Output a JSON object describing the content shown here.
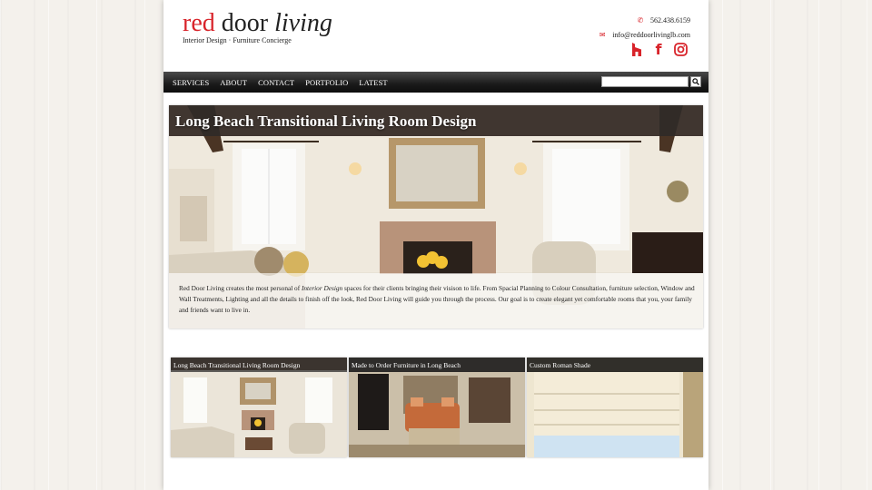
{
  "header": {
    "logo": {
      "red": "red",
      "door": "door",
      "living": "living"
    },
    "tagline": "Interior Design · Furniture Concierge",
    "phone": "562.438.6159",
    "email": "info@reddoorlivinglb.com",
    "social": [
      "houzz-icon",
      "facebook-icon",
      "instagram-icon"
    ]
  },
  "nav": {
    "items": [
      "SERVICES",
      "ABOUT",
      "CONTACT",
      "PORTFOLIO",
      "LATEST"
    ],
    "search_placeholder": ""
  },
  "hero": {
    "title": "Long Beach Transitional Living Room Design",
    "description_parts": [
      "Red Door Living creates the most personal of ",
      "Interior Design",
      " spaces for their clients bringing their visison to life. From Spacial Planning to Colour Consultation, furniture selection, Window and Wall Treatments, Lighting and all the details to finish off the look, Red Door Living will guide you through the process. Our goal is to create elegant yet comfortable rooms that you, your family and friends want to live in."
    ]
  },
  "thumbnails": [
    {
      "title": "Long Beach Transitional Living Room Design"
    },
    {
      "title": "Made to Order Furniture in Long Beach"
    },
    {
      "title": "Custom Roman Shade"
    }
  ],
  "colors": {
    "brand_red": "#d8232a",
    "nav_bg": "#1a1a1a"
  }
}
